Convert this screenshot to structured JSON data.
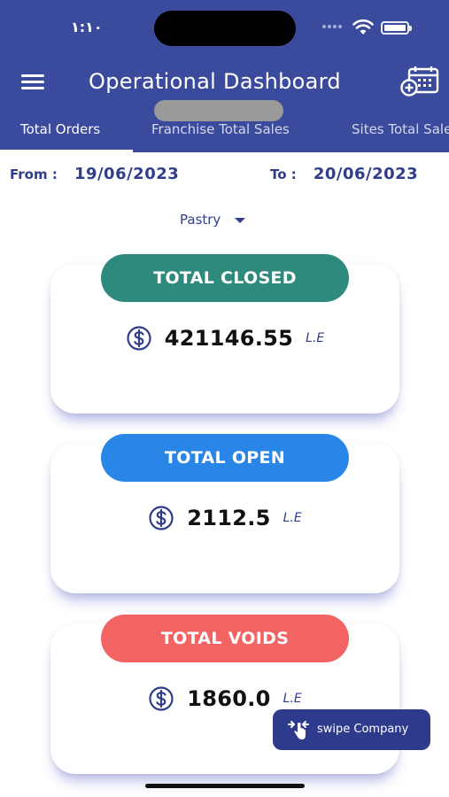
{
  "status_bar": {
    "time": "١:١٠"
  },
  "header": {
    "title": "Operational Dashboard",
    "tabs": [
      {
        "label": "Total Orders",
        "active": true
      },
      {
        "label": "Franchise Total Sales",
        "active": false
      },
      {
        "label": "Sites Total Sales",
        "active": false
      }
    ]
  },
  "dates": {
    "from_label": "From :",
    "from_value": "19/06/2023",
    "to_label": "To :",
    "to_value": "20/06/2023"
  },
  "filter": {
    "selected": "Pastry"
  },
  "cards": [
    {
      "label": "TOTAL CLOSED",
      "amount": "421146.55",
      "unit": "L.E",
      "color": "#2e8a7c"
    },
    {
      "label": "TOTAL OPEN",
      "amount": "2112.5",
      "unit": "L.E",
      "color": "#2a86e6"
    },
    {
      "label": "TOTAL VOIDS",
      "amount": "1860.0",
      "unit": "L.E",
      "color": "#f26464"
    }
  ],
  "swipe_button": {
    "label": "swipe Company"
  },
  "colors": {
    "header": "#3a4a9c",
    "accent": "#2f3d8a",
    "button": "#2e3a8c"
  },
  "icons": [
    "menu-icon",
    "calendar-add-icon",
    "dollar-icon",
    "swipe-hand-icon",
    "wifi-icon",
    "battery-icon"
  ]
}
